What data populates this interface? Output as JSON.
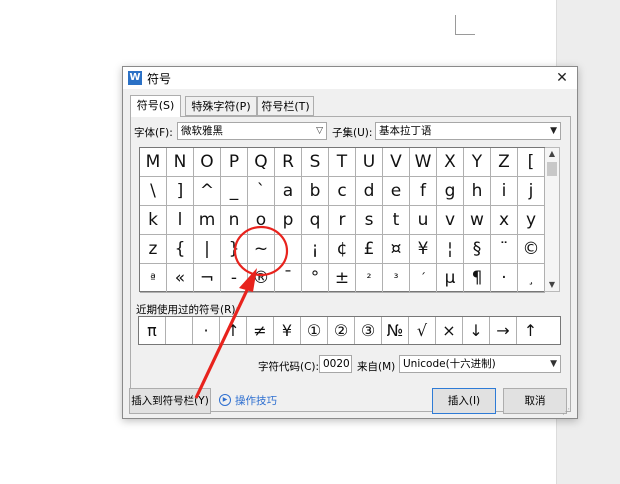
{
  "dialog": {
    "icon_letter": "W",
    "title": "符号",
    "close_glyph": "✕",
    "tabs": [
      {
        "label": "符号(S)"
      },
      {
        "label": "特殊字符(P)"
      },
      {
        "label": "符号栏(T)"
      }
    ],
    "font_label": "字体(F):",
    "font_value": "微软雅黑",
    "subset_label": "子集(U):",
    "subset_value": "基本拉丁语",
    "grid_rows": [
      [
        "M",
        "N",
        "O",
        "P",
        "Q",
        "R",
        "S",
        "T",
        "U",
        "V",
        "W",
        "X",
        "Y",
        "Z",
        "["
      ],
      [
        "\\",
        "]",
        "^",
        "_",
        "`",
        "a",
        "b",
        "c",
        "d",
        "e",
        "f",
        "g",
        "h",
        "i",
        "j"
      ],
      [
        "k",
        "l",
        "m",
        "n",
        "o",
        "p",
        "q",
        "r",
        "s",
        "t",
        "u",
        "v",
        "w",
        "x",
        "y"
      ],
      [
        "z",
        "{",
        "|",
        "}",
        "~",
        "",
        "¡",
        "¢",
        "£",
        "¤",
        "¥",
        "¦",
        "§",
        "¨",
        "©"
      ],
      [
        "ª",
        "«",
        "¬",
        "-",
        "®",
        "¯",
        "°",
        "±",
        "²",
        "³",
        "´",
        "µ",
        "¶",
        "·",
        "¸"
      ]
    ],
    "recent_label": "近期使用过的符号(R):",
    "recent_symbols": [
      "π",
      "",
      "·",
      "↑",
      "≠",
      "¥",
      "①",
      "②",
      "③",
      "№",
      "√",
      "×",
      "↓",
      "→",
      "↑"
    ],
    "char_code_label": "字符代码(C):",
    "char_code_value": "0020",
    "from_label": "来自(M)",
    "from_value": "Unicode(十六进制)",
    "insert_to_bar_label": "插入到符号栏(Y)",
    "tips_label": "操作技巧",
    "insert_label": "插入(I)",
    "cancel_label": "取消"
  },
  "annotation": {
    "color": "#e8231d"
  }
}
